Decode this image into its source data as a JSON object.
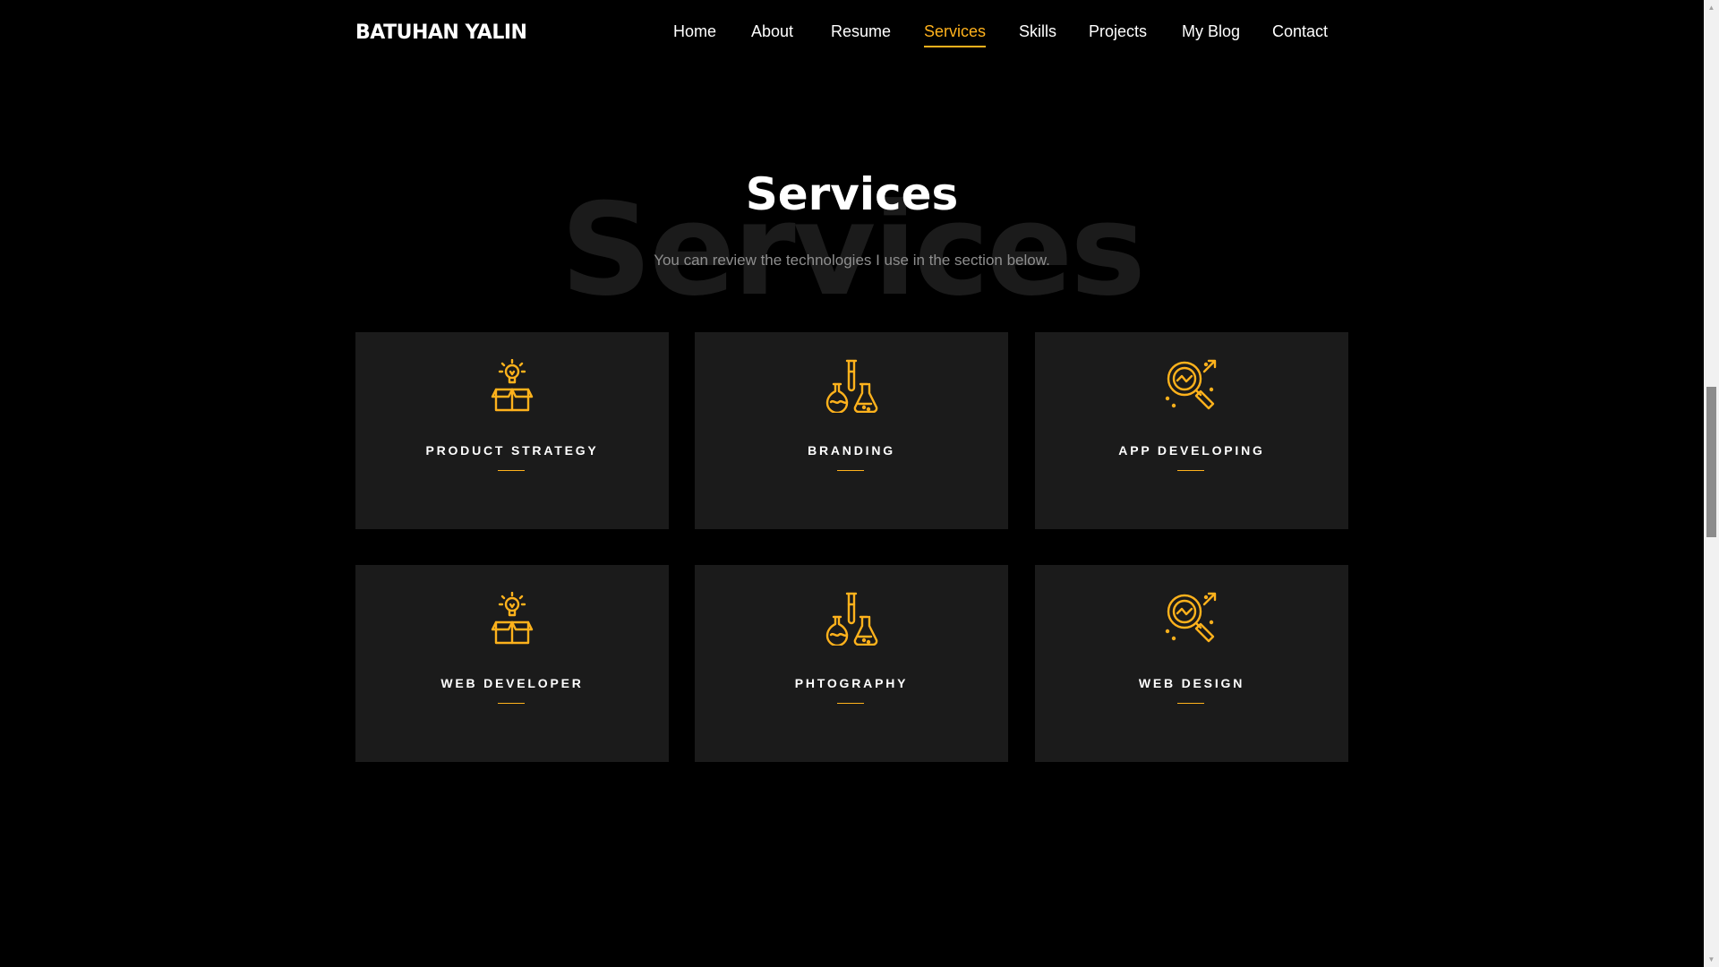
{
  "header": {
    "logo": "BATUHAN YALIN",
    "nav": [
      {
        "label": "Home",
        "active": false
      },
      {
        "label": "About",
        "active": false
      },
      {
        "label": "Resume",
        "active": false
      },
      {
        "label": "Services",
        "active": true
      },
      {
        "label": "Skills",
        "active": false
      },
      {
        "label": "Projects",
        "active": false
      },
      {
        "label": "My Blog",
        "active": false
      },
      {
        "label": "Contact",
        "active": false
      }
    ]
  },
  "section": {
    "background_title": "Services",
    "title": "Services",
    "subtitle": "You can review the technologies I use in the section below."
  },
  "services": [
    {
      "title": "PRODUCT STRATEGY",
      "icon": "lightbulb-box-icon"
    },
    {
      "title": "BRANDING",
      "icon": "chemistry-flasks-icon"
    },
    {
      "title": "APP DEVELOPING",
      "icon": "magnifier-search-icon"
    },
    {
      "title": "WEB DEVELOPER",
      "icon": "lightbulb-box-icon"
    },
    {
      "title": "PHTOGRAPHY",
      "icon": "chemistry-flasks-icon"
    },
    {
      "title": "WEB DESIGN",
      "icon": "magnifier-search-icon"
    }
  ],
  "colors": {
    "accent": "#ffb21c",
    "background": "#000000",
    "card": "#1b1b1b",
    "ghost_text": "#1b1b1b",
    "muted_text": "#8e8e8e"
  }
}
